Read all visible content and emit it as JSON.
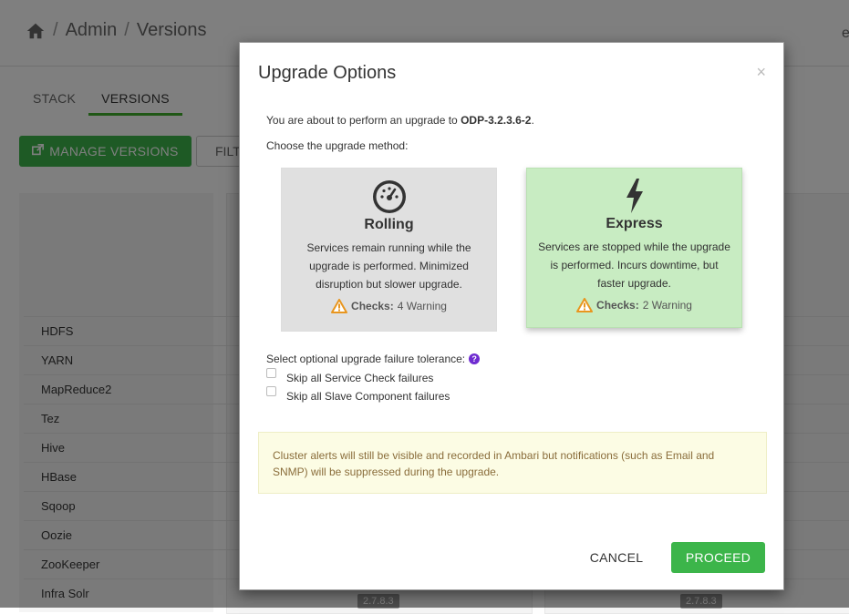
{
  "breadcrumb": {
    "part1": "Admin",
    "part2": "Versions",
    "separator": "/"
  },
  "header": {
    "corner_text": "e"
  },
  "tabs": [
    {
      "label": "STACK"
    },
    {
      "label": "VERSIONS"
    }
  ],
  "toolbar": {
    "manage_label": "MANAGE VERSIONS",
    "filter_label": "FILT"
  },
  "services": [
    "HDFS",
    "YARN",
    "MapReduce2",
    "Tez",
    "Hive",
    "HBase",
    "Sqoop",
    "Oozie",
    "ZooKeeper",
    "Infra Solr"
  ],
  "version_badges": [
    "2.7.8.3",
    "2.7.8.3"
  ],
  "modal": {
    "title": "Upgrade Options",
    "close_symbol": "×",
    "intro_prefix": "You are about to perform an upgrade to",
    "intro_version": "ODP-3.2.3.6-2",
    "intro_suffix": ".",
    "choose_label": "Choose the upgrade method:",
    "options": {
      "rolling": {
        "name": "Rolling",
        "description": "Services remain running while the upgrade is performed. Minimized disruption but slower upgrade.",
        "checks_label": "Checks:",
        "checks_value": "4 Warning"
      },
      "express": {
        "name": "Express",
        "description": "Services are stopped while the upgrade is performed. Incurs downtime, but faster upgrade.",
        "checks_label": "Checks:",
        "checks_value": "2 Warning"
      }
    },
    "tolerance_label": "Select optional upgrade failure tolerance:",
    "help_symbol": "?",
    "checkbox_service_check": "Skip all Service Check failures",
    "checkbox_slave_component": "Skip all Slave Component failures",
    "alert_text": "Cluster alerts will still be visible and recorded in Ambari but notifications (such as Email and SNMP) will be suppressed during the upgrade.",
    "cancel_label": "CANCEL",
    "proceed_label": "PROCEED"
  },
  "colors": {
    "primary_green": "#3cb54a",
    "express_bg": "#c8ecc2",
    "rolling_bg": "#e0e0e0",
    "warning_orange": "#e8961f",
    "alert_bg": "#fcfce4",
    "alert_text": "#8a6d3b"
  }
}
